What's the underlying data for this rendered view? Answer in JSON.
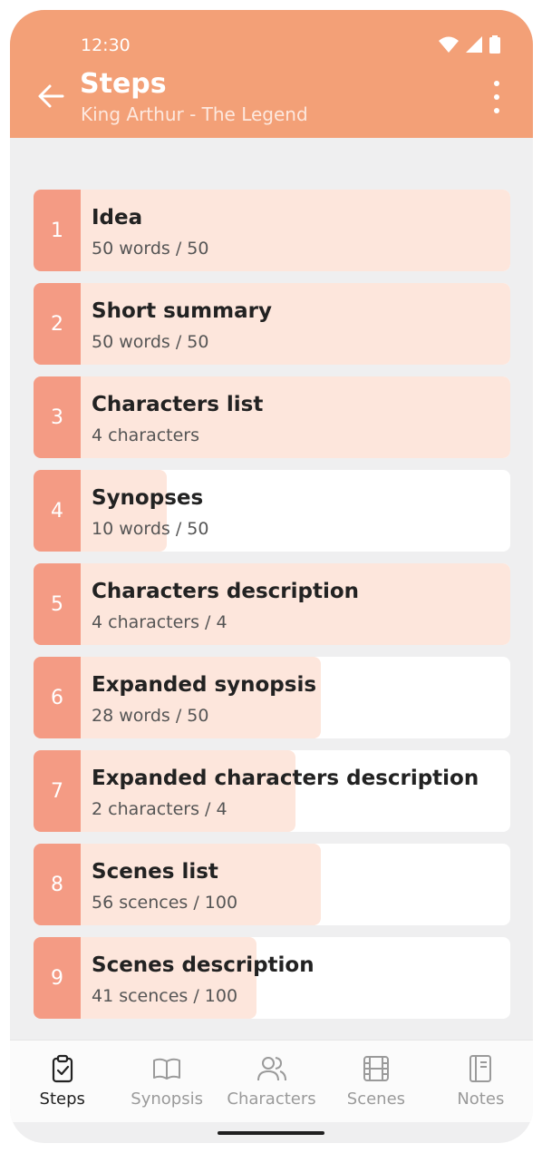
{
  "status": {
    "time": "12:30"
  },
  "header": {
    "title": "Steps",
    "subtitle": "King Arthur - The Legend"
  },
  "steps": [
    {
      "num": "1",
      "title": "Idea",
      "sub": "50 words / 50",
      "progress": 1.0
    },
    {
      "num": "2",
      "title": "Short summary",
      "sub": "50 words / 50",
      "progress": 1.0
    },
    {
      "num": "3",
      "title": "Characters list",
      "sub": "4 characters",
      "progress": 1.0
    },
    {
      "num": "4",
      "title": "Synopses",
      "sub": "10 words / 50",
      "progress": 0.2
    },
    {
      "num": "5",
      "title": "Characters description",
      "sub": "4 characters / 4",
      "progress": 1.0
    },
    {
      "num": "6",
      "title": "Expanded synopsis",
      "sub": "28 words / 50",
      "progress": 0.56
    },
    {
      "num": "7",
      "title": "Expanded characters description",
      "sub": "2 characters / 4",
      "progress": 0.5
    },
    {
      "num": "8",
      "title": "Scenes list",
      "sub": "56 scences / 100",
      "progress": 0.56
    },
    {
      "num": "9",
      "title": "Scenes description",
      "sub": "41 scences / 100",
      "progress": 0.41
    }
  ],
  "nav": [
    {
      "label": "Steps",
      "icon": "clipboard-check-icon",
      "active": true
    },
    {
      "label": "Synopsis",
      "icon": "book-open-icon",
      "active": false
    },
    {
      "label": "Characters",
      "icon": "users-icon",
      "active": false
    },
    {
      "label": "Scenes",
      "icon": "film-icon",
      "active": false
    },
    {
      "label": "Notes",
      "icon": "notebook-icon",
      "active": false
    }
  ],
  "colors": {
    "header": "#f3a077",
    "step_number": "#f49b84",
    "progress": "#fde6dc",
    "background": "#efeff0"
  }
}
